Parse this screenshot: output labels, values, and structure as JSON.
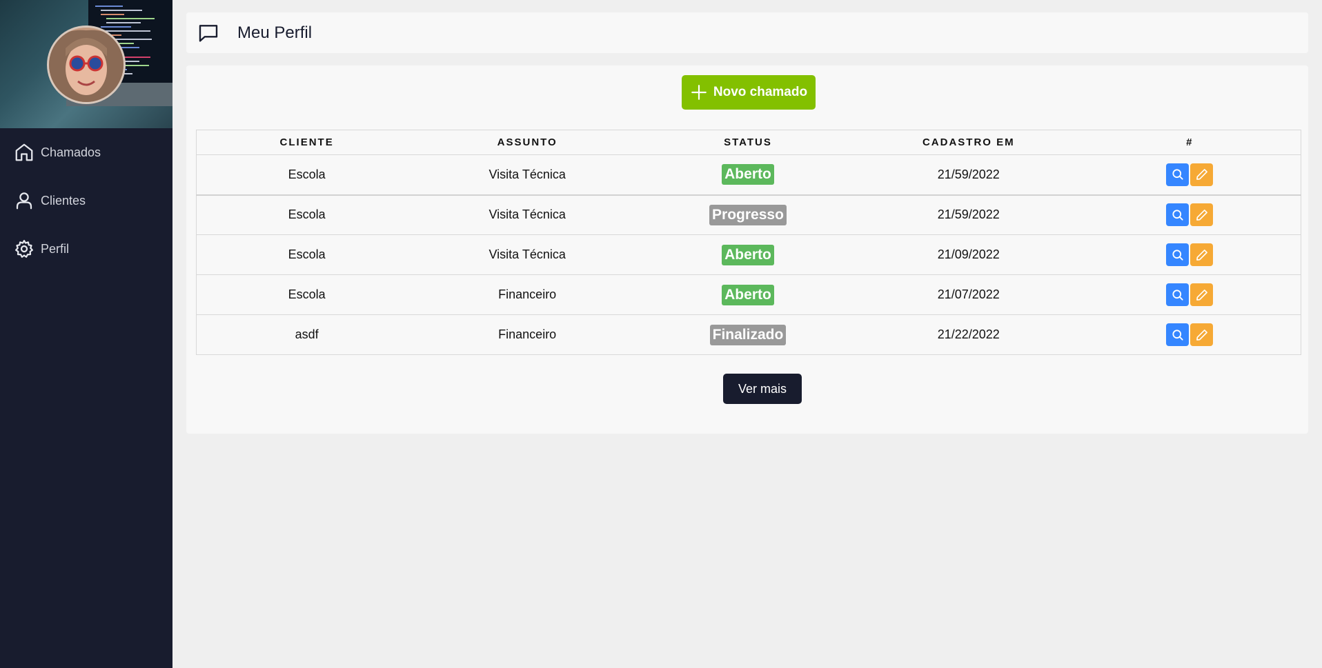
{
  "sidebar": {
    "items": [
      {
        "label": "Chamados",
        "icon": "home-icon"
      },
      {
        "label": "Clientes",
        "icon": "user-icon"
      },
      {
        "label": "Perfil",
        "icon": "gear-icon"
      }
    ]
  },
  "header": {
    "title": "Meu Perfil",
    "icon": "message-square-icon"
  },
  "toolbar": {
    "new_label": "Novo chamado"
  },
  "table": {
    "headers": [
      "CLIENTE",
      "ASSUNTO",
      "STATUS",
      "CADASTRO EM",
      "#"
    ],
    "rows": [
      {
        "cliente": "Escola",
        "assunto": "Visita Técnica",
        "status": "Aberto",
        "cadastro": "21/59/2022"
      },
      {
        "cliente": "Escola",
        "assunto": "Visita Técnica",
        "status": "Progresso",
        "cadastro": "21/59/2022"
      },
      {
        "cliente": "Escola",
        "assunto": "Visita Técnica",
        "status": "Aberto",
        "cadastro": "21/09/2022"
      },
      {
        "cliente": "Escola",
        "assunto": "Financeiro",
        "status": "Aberto",
        "cadastro": "21/07/2022"
      },
      {
        "cliente": "asdf",
        "assunto": "Financeiro",
        "status": "Finalizado",
        "cadastro": "21/22/2022"
      }
    ]
  },
  "footer": {
    "more_label": "Ver mais"
  },
  "colors": {
    "sidebar_bg": "#181c2e",
    "accent_green": "#83c000",
    "status_open": "#5cb85c",
    "status_other": "#999999",
    "search_blue": "#3586ff",
    "edit_orange": "#f6a935"
  }
}
